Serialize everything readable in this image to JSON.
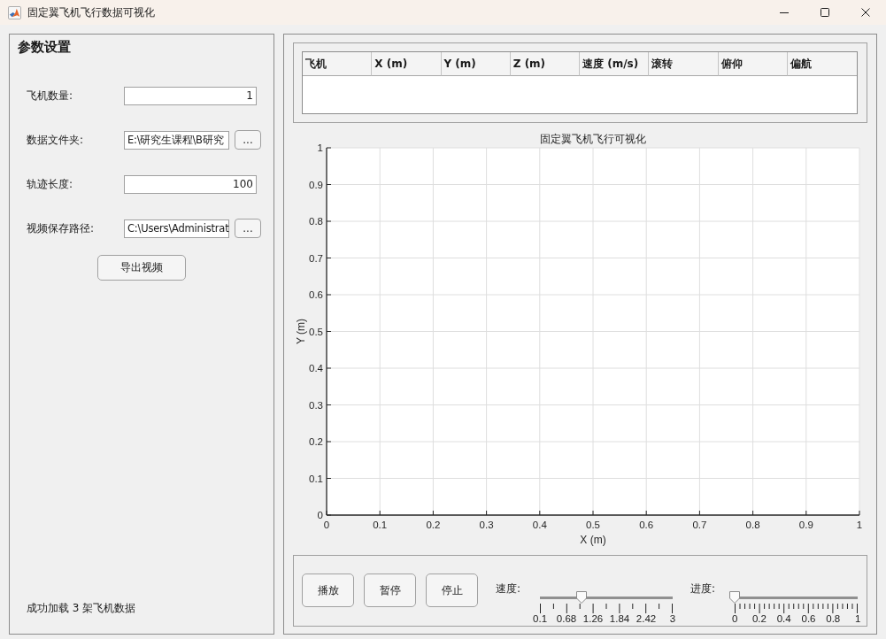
{
  "window": {
    "title": "固定翼飞机飞行数据可视化"
  },
  "settings": {
    "title": "参数设置",
    "fields": [
      {
        "label": "飞机数量:",
        "kind": "number",
        "value": "1"
      },
      {
        "label": "数据文件夹:",
        "kind": "path",
        "value": "E:\\研究生课程\\B研究",
        "browse": "..."
      },
      {
        "label": "轨迹长度:",
        "kind": "number",
        "value": "100"
      },
      {
        "label": "视频保存路径:",
        "kind": "path",
        "value": "C:\\Users\\Administrat",
        "browse": "..."
      }
    ],
    "export_button": "导出视频",
    "status": "成功加载 3 架飞机数据"
  },
  "table": {
    "columns": [
      "飞机",
      "X (m)",
      "Y (m)",
      "Z (m)",
      "速度 (m/s)",
      "滚转",
      "俯仰",
      "偏航"
    ]
  },
  "plot": {
    "chart_data": [
      {
        "type": "line",
        "title": "固定翼飞机飞行可视化",
        "xlabel": "X (m)",
        "ylabel": "Y (m)",
        "xlim": [
          0,
          1
        ],
        "ylim": [
          0,
          1
        ],
        "xticks": [
          {
            "value": 0,
            "label": "0"
          },
          {
            "value": 0.1,
            "label": "0.1"
          },
          {
            "value": 0.2,
            "label": "0.2"
          },
          {
            "value": 0.3,
            "label": "0.3"
          },
          {
            "value": 0.4,
            "label": "0.4"
          },
          {
            "value": 0.5,
            "label": "0.5"
          },
          {
            "value": 0.6,
            "label": "0.6"
          },
          {
            "value": 0.7,
            "label": "0.7"
          },
          {
            "value": 0.8,
            "label": "0.8"
          },
          {
            "value": 0.9,
            "label": "0.9"
          },
          {
            "value": 1,
            "label": "1"
          }
        ],
        "yticks": [
          {
            "value": 0,
            "label": "0"
          },
          {
            "value": 0.1,
            "label": "0.1"
          },
          {
            "value": 0.2,
            "label": "0.2"
          },
          {
            "value": 0.3,
            "label": "0.3"
          },
          {
            "value": 0.4,
            "label": "0.4"
          },
          {
            "value": 0.5,
            "label": "0.5"
          },
          {
            "value": 0.6,
            "label": "0.6"
          },
          {
            "value": 0.7,
            "label": "0.7"
          },
          {
            "value": 0.8,
            "label": "0.8"
          },
          {
            "value": 0.9,
            "label": "0.9"
          },
          {
            "value": 1,
            "label": "1"
          }
        ],
        "grid": true
      }
    ]
  },
  "playback": {
    "buttons": [
      "播放",
      "暂停",
      "停止"
    ],
    "sliders": [
      {
        "label": "速度:",
        "kind": "coarse",
        "level": 0.31,
        "scale": [
          "0.1",
          "0.68",
          "1.26",
          "1.84",
          "2.42",
          "3"
        ]
      },
      {
        "label": "进度:",
        "kind": "fine",
        "level": 0,
        "scale": [
          "0",
          "0.2",
          "0.4",
          "0.6",
          "0.8",
          "1"
        ]
      }
    ]
  }
}
